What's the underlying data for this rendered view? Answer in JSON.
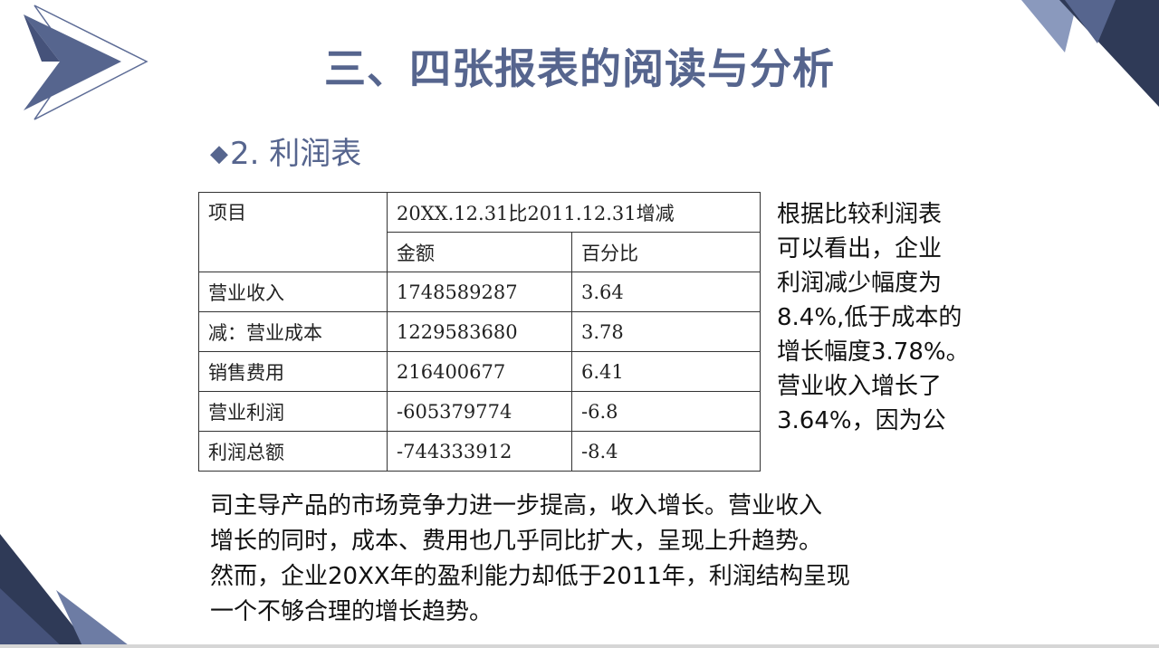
{
  "title": "三、四张报表的阅读与分析",
  "subtitle": {
    "bullet": "◆",
    "text": "2. 利润表"
  },
  "table": {
    "header_item": "项目",
    "header_period": "20XX.12.31比2011.12.31增减",
    "sub_headers": [
      "金额",
      "百分比"
    ],
    "rows": [
      {
        "item": "营业收入",
        "amount": "1748589287",
        "percent": "3.64"
      },
      {
        "item": "减：营业成本",
        "amount": "1229583680",
        "percent": "3.78"
      },
      {
        "item": "销售费用",
        "amount": "216400677",
        "percent": "6.41"
      },
      {
        "item": "营业利润",
        "amount": "-605379774",
        "percent": "-6.8"
      },
      {
        "item": "利润总额",
        "amount": "-744333912",
        "percent": "-8.4"
      }
    ]
  },
  "side_text": [
    "根据比较利润表",
    "可以看出，企业",
    "利润减少幅度为",
    "8.4%,低于成本的",
    "增长幅度3.78%。",
    "营业收入增长了",
    "3.64%，因为公"
  ],
  "bottom_text": [
    "司主导产品的市场竞争力进一步提高，收入增长。营业收入",
    "增长的同时，成本、费用也几乎同比扩大，呈现上升趋势。",
    "然而，企业20XX年的盈利能力却低于2011年，利润结构呈现",
    "一个不够合理的增长趋势。"
  ],
  "colors": {
    "accent": "#56658e",
    "dark_navy": "#2f3a57",
    "light_blue": "#8d9cc0"
  }
}
